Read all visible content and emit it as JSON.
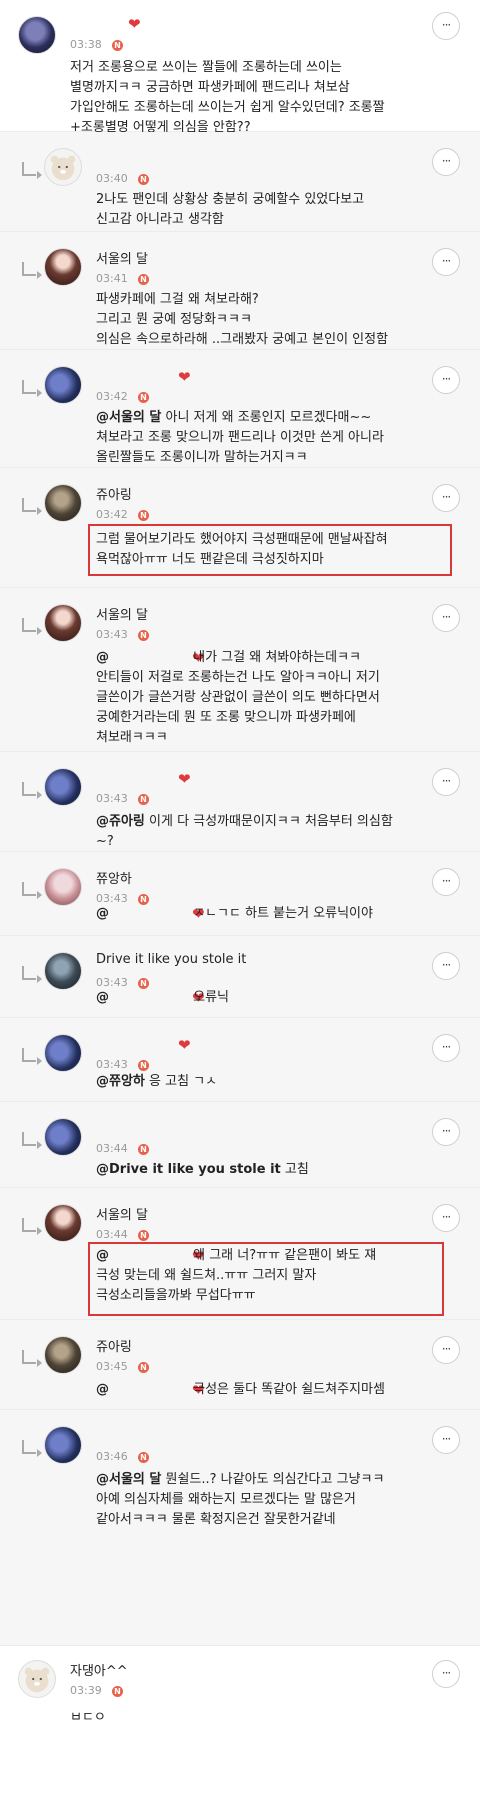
{
  "colors": {
    "heart": "#e0393e",
    "badge": "#e8614a",
    "highlight_border": "#d9383a",
    "reply_bg": "#f6f6f6"
  },
  "icons": {
    "heart": "heart-icon",
    "more": "more-dots-icon",
    "reply": "reply-arrow-icon",
    "new_badge": "new-badge-icon"
  },
  "ui": {
    "more_label": "···",
    "new_badge": "N",
    "heart": "❤"
  },
  "comments": [
    {
      "author": "",
      "time": "03:38",
      "heart": true,
      "lines": [
        "저거 조롱용으로 쓰이는 짤들에 조롱하는데 쓰이는",
        "별명까지ㅋㅋ 궁금하면 파생카페에 팬드리나 쳐보삼",
        "가입안해도 조롱하는데 쓰이는거 쉽게 알수있던데? 조롱짤",
        "+조롱별명 어떻게 의심을 안함??"
      ]
    },
    {
      "author": "",
      "time": "03:40",
      "lines": [
        "2나도 팬인데 상황상 충분히 궁예할수 있었다보고",
        "신고감 아니라고 생각함"
      ]
    },
    {
      "author": "서울의 달",
      "time": "03:41",
      "lines": [
        "파생카페에 그걸 왜 쳐보라해?",
        "그리고 뭔 궁예 정당화ㅋㅋㅋ",
        "의심은 속으로하라해 ..그래봤자 궁예고 본인이 인정함"
      ]
    },
    {
      "author": "",
      "time": "03:42",
      "heart": true,
      "mention": "@서울의 달",
      "first_rest": " 아니 저게 왜 조롱인지 모르겠다매~~",
      "lines": [
        "쳐보라고 조롱 맞으니까 팬드리나 이것만 쓴게 아니라",
        "올린짤들도 조롱이니까 말하는거지ㅋㅋ"
      ]
    },
    {
      "author": "쥬아링",
      "time": "03:42",
      "lines": [
        "그럼 물어보기라도 했어야지 극성팬때문에 맨날싸잡혀",
        "욕먹잖아ㅠㅠ 너도 팬같은데 극성짓하지마"
      ]
    },
    {
      "author": "서울의 달",
      "time": "03:43",
      "heart": true,
      "mention": "@",
      "first_rest": "  내가 그걸 왜 쳐봐야하는데ㅋㅋ",
      "lines": [
        "안티들이 저걸로 조롱하는건 나도 알아ㅋㅋ아니 저기",
        "글쓴이가 글쓴거랑 상관없이 글쓴이 의도 뻔하다면서",
        "궁예한거라는데 뭔 또 조롱 맞으니까 파생카페에",
        "쳐보래ㅋㅋㅋ"
      ]
    },
    {
      "author": "",
      "time": "03:43",
      "heart": true,
      "mention": "@쥬아링",
      "first_rest": " 이게 다 극성까때문이지ㅋㅋ 처음부터 의심함",
      "lines": [
        "~?"
      ]
    },
    {
      "author": "쮸앙하",
      "time": "03:43",
      "heart": true,
      "mention": "@",
      "first_rest": "  ㅈㄴㄱㄷ 하트 붙는거 오류닉이야"
    },
    {
      "author": "Drive it like you stole it",
      "time": "03:43",
      "heart": true,
      "mention": "@",
      "first_rest": "  오류닉"
    },
    {
      "author": "",
      "time": "03:43",
      "heart": true,
      "mention": "@쮸앙하",
      "first_rest": " 응 고침 ㄱㅅ"
    },
    {
      "author": "",
      "time": "03:44",
      "mention": "@Drive it like you stole it",
      "first_rest": "  고침"
    },
    {
      "author": "서울의 달",
      "time": "03:44",
      "heart": true,
      "mention": "@",
      "first_rest": "  왜 그래 너?ㅠㅠ 같은팬이 봐도 쟤",
      "lines": [
        "극성 맞는데 왜 쉴드쳐..ㅠㅠ 그러지 말자",
        "극성소리들을까봐 무섭다ㅠㅠ"
      ]
    },
    {
      "author": "쥬아링",
      "time": "03:45",
      "heart": true,
      "mention": "@",
      "first_rest": "  극성은 둘다 똑같아 쉴드쳐주지마셈"
    },
    {
      "author": "",
      "time": "03:46",
      "mention": "@서울의 달",
      "first_rest": " 뭔쉴드..? 나같아도 의심간다고 그냥ㅋㅋ",
      "lines": [
        "아예 의심자체를 왜하는지 모르겠다는 말 많은거",
        "같아서ㅋㅋㅋ 물론 확정지은건 잘못한거같네"
      ]
    },
    {
      "author": "자댕아^^",
      "time": "03:39",
      "lines": [
        "ㅂㄷㅇ"
      ]
    }
  ]
}
